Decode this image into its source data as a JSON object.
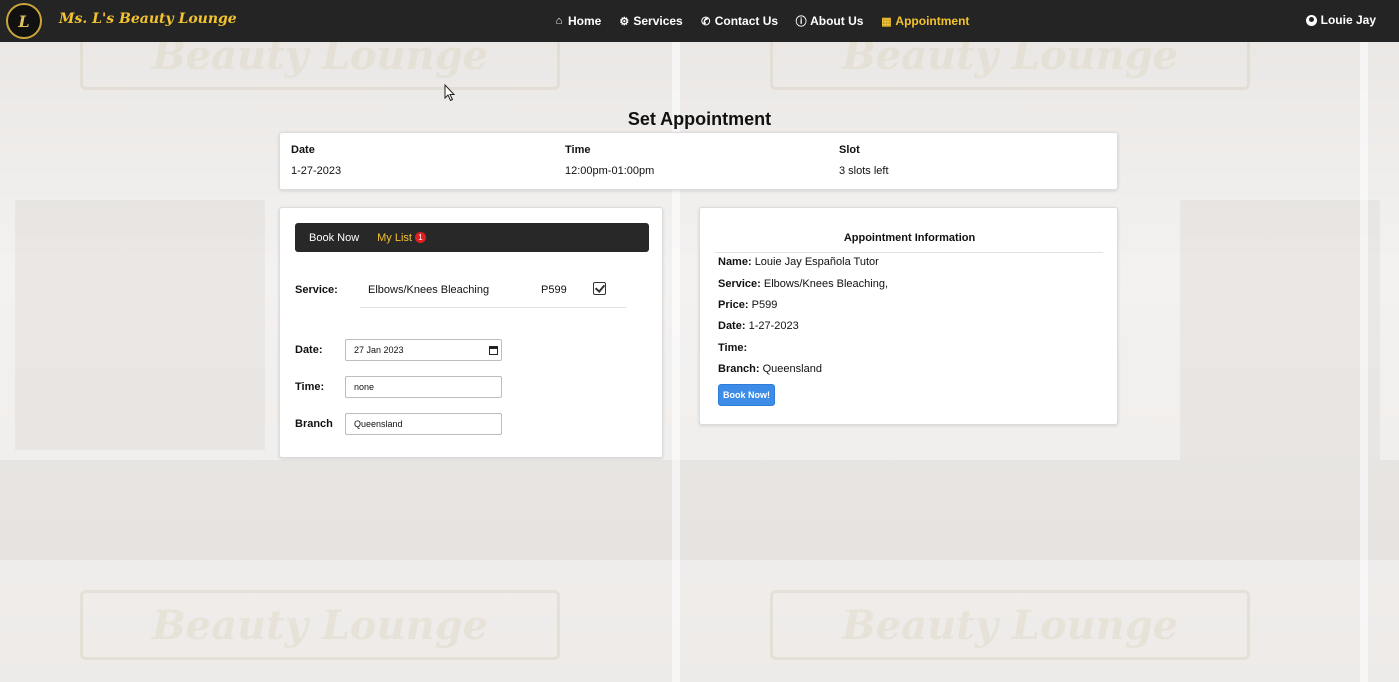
{
  "brand": {
    "name": "Ms. L's Beauty Lounge",
    "logo_text": "L"
  },
  "nav": {
    "items": [
      {
        "label": "Home",
        "icon": "home-icon"
      },
      {
        "label": "Services",
        "icon": "cogs-icon"
      },
      {
        "label": "Contact Us",
        "icon": "phone-icon"
      },
      {
        "label": "About Us",
        "icon": "info-icon"
      },
      {
        "label": "Appointment",
        "icon": "calendar-icon",
        "active": true
      }
    ],
    "user": "Louie Jay"
  },
  "background_sign": "Beauty Lounge",
  "page_title": "Set Appointment",
  "summary": {
    "date_label": "Date",
    "date_value": "1-27-2023",
    "time_label": "Time",
    "time_value": "12:00pm-01:00pm",
    "slot_label": "Slot",
    "slot_value": "3 slots left"
  },
  "tabs": {
    "book_now": "Book Now",
    "my_list": "My List",
    "my_list_count": "1"
  },
  "service": {
    "label": "Service:",
    "name": "Elbows/Knees Bleaching",
    "price": "P599",
    "checked": true
  },
  "form": {
    "date_label": "Date:",
    "date_value": "27 Jan 2023",
    "time_label": "Time:",
    "time_value": "none",
    "branch_label": "Branch",
    "branch_value": "Queensland"
  },
  "info": {
    "title": "Appointment Information",
    "name_label": "Name:",
    "name_value": "Louie Jay Española Tutor",
    "service_label": "Service:",
    "service_value": "Elbows/Knees Bleaching,",
    "price_label": "Price:",
    "price_value": "P599",
    "date_label": "Date:",
    "date_value": "1-27-2023",
    "time_label": "Time:",
    "time_value": "",
    "branch_label": "Branch:",
    "branch_value": "Queensland",
    "button": "Book Now!"
  },
  "colors": {
    "nav_bg": "#242424",
    "accent": "#f2c230",
    "button": "#3d8de8",
    "badge": "#e02020"
  }
}
